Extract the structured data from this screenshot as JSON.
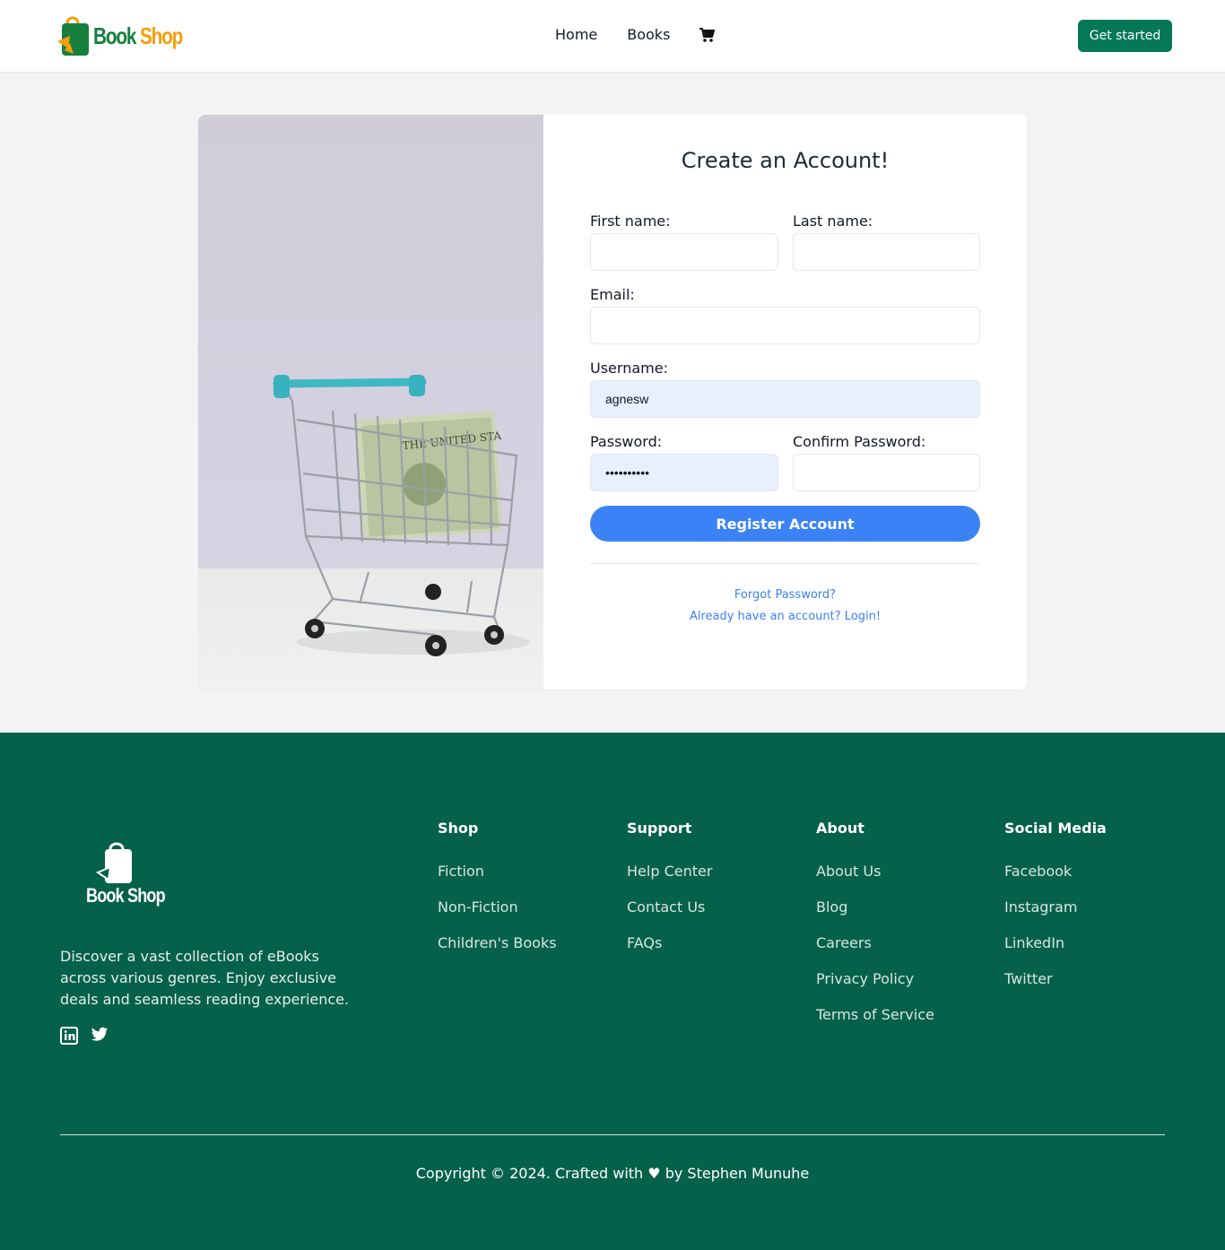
{
  "header": {
    "logo_word1": "Book",
    "logo_word2": "Shop",
    "nav": {
      "home": "Home",
      "books": "Books"
    },
    "cart_icon": "cart-icon",
    "get_started": "Get started"
  },
  "form": {
    "title": "Create an Account!",
    "first_name_label": "First name:",
    "last_name_label": "Last name:",
    "email_label": "Email:",
    "username_label": "Username:",
    "username_value": "agnesw",
    "password_label": "Password:",
    "password_value": "••••••••••",
    "confirm_password_label": "Confirm Password:",
    "register_label": "Register Account",
    "forgot_password": "Forgot Password?",
    "login_link": "Already have an account? Login!"
  },
  "footer": {
    "logo_text": "Book Shop",
    "description": "Discover a vast collection of eBooks across various genres. Enjoy exclusive deals and seamless reading experience.",
    "social_icons": [
      "linkedin-icon",
      "twitter-icon"
    ],
    "columns": [
      {
        "title": "Shop",
        "items": [
          "Fiction",
          "Non-Fiction",
          "Children's Books"
        ]
      },
      {
        "title": "Support",
        "items": [
          "Help Center",
          "Contact Us",
          "FAQs"
        ]
      },
      {
        "title": "About",
        "items": [
          "About Us",
          "Blog",
          "Careers",
          "Privacy Policy",
          "Terms of Service"
        ]
      },
      {
        "title": "Social Media",
        "items": [
          "Facebook",
          "Instagram",
          "LinkedIn",
          "Twitter"
        ]
      }
    ],
    "copyright": "Copyright © 2024. Crafted with ♥ by Stephen Munuhe"
  },
  "colors": {
    "brand_green": "#047857",
    "footer_bg": "#06614a",
    "primary_blue": "#3b82f6",
    "logo_orange": "#f59e0b"
  }
}
